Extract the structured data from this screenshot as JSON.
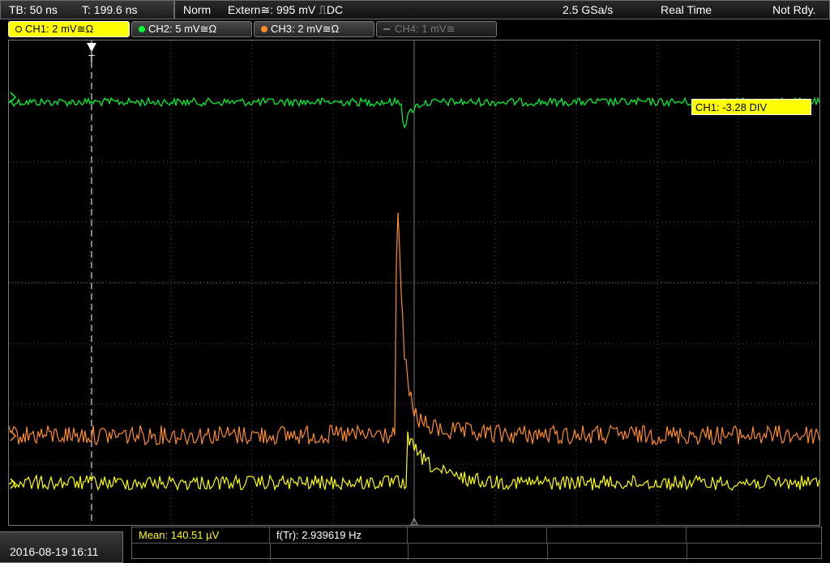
{
  "status_bar": {
    "timebase": "TB: 50 ns",
    "trigger_time": "T: 199.6 ns",
    "trigger_mode": "Norm",
    "trigger_source": "Extern≅: 995 mV ⎍DC",
    "sample_rate": "2.5 GSa/s",
    "acquisition_mode": "Real Time",
    "ready_state": "Not Rdy."
  },
  "channels": [
    {
      "id": "ch1",
      "label": "CH1: 2 mV≅Ω",
      "color": "#ffff00",
      "active": true,
      "enabled": true
    },
    {
      "id": "ch2",
      "label": "CH2: 5 mV≅Ω",
      "color": "#00ff33",
      "active": false,
      "enabled": true
    },
    {
      "id": "ch3",
      "label": "CH3: 2 mV≅Ω",
      "color": "#ff8c2a",
      "active": false,
      "enabled": true
    },
    {
      "id": "ch4",
      "label": "CH4: 1 mV≅",
      "color": "#777777",
      "active": false,
      "enabled": false
    }
  ],
  "offset_readout": "CH1: -3.28 DIV",
  "trigger_marker": "T",
  "measurements": {
    "mean": "Mean: 140.51 µV",
    "frequency": "f(Tr): 2.939619 Hz"
  },
  "timestamp": "2016-08-19 16:11",
  "colors": {
    "ch1": "#ffff00",
    "ch2": "#00ff33",
    "ch3": "#ff8c2a",
    "grid": "#555555"
  }
}
